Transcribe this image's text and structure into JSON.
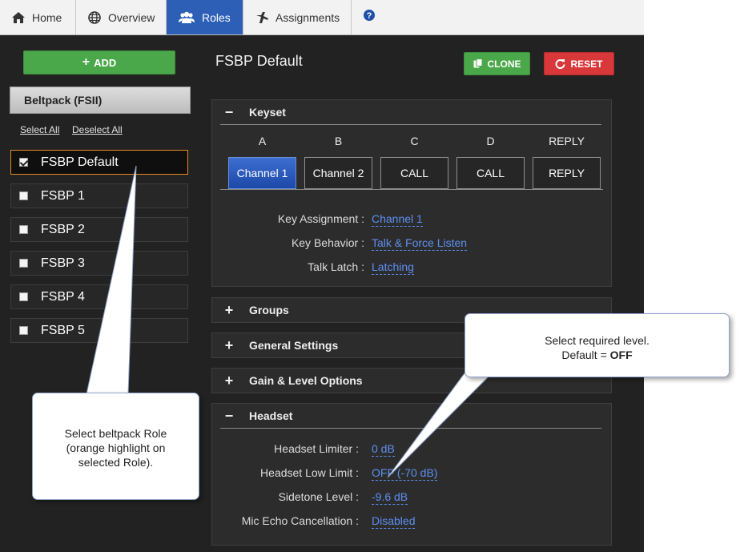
{
  "nav": {
    "tabs": [
      {
        "label": "Home",
        "icon": "home-icon"
      },
      {
        "label": "Overview",
        "icon": "globe-icon"
      },
      {
        "label": "Roles",
        "icon": "users-icon"
      },
      {
        "label": "Assignments",
        "icon": "assignments-icon"
      }
    ],
    "active_tab": "Roles",
    "help_icon": "help-icon"
  },
  "sidebar": {
    "add_label": "ADD",
    "group_label": "Beltpack (FSII)",
    "select_all": "Select All",
    "deselect_all": "Deselect All",
    "roles": [
      {
        "label": "FSBP Default",
        "checked": true
      },
      {
        "label": "FSBP 1",
        "checked": false
      },
      {
        "label": "FSBP 2",
        "checked": false
      },
      {
        "label": "FSBP 3",
        "checked": false
      },
      {
        "label": "FSBP 4",
        "checked": false
      },
      {
        "label": "FSBP 5",
        "checked": false
      }
    ]
  },
  "main": {
    "title": "FSBP Default",
    "clone_label": "CLONE",
    "reset_label": "RESET",
    "keyset": {
      "title": "Keyset",
      "letters": [
        "A",
        "B",
        "C",
        "D",
        "REPLY"
      ],
      "keys": [
        "Channel 1",
        "Channel 2",
        "CALL",
        "CALL",
        "REPLY"
      ],
      "active_key": "Channel 1",
      "props": [
        {
          "label": "Key Assignment :",
          "value": "Channel 1"
        },
        {
          "label": "Key Behavior :",
          "value": "Talk & Force Listen"
        },
        {
          "label": "Talk Latch :",
          "value": "Latching"
        }
      ]
    },
    "collapsed_sections": [
      "Groups",
      "General Settings",
      "Gain & Level Options"
    ],
    "headset": {
      "title": "Headset",
      "props": [
        {
          "label": "Headset Limiter :",
          "value": "0 dB"
        },
        {
          "label": "Headset Low Limit :",
          "value": "OFF (-70 dB)"
        },
        {
          "label": "Sidetone Level :",
          "value": "-9.6 dB"
        },
        {
          "label": "Mic Echo Cancellation :",
          "value": "Disabled"
        }
      ]
    }
  },
  "callouts": {
    "level": {
      "line1": "Select required level.",
      "line2_prefix": "Default = ",
      "line2_bold": "OFF"
    },
    "role": {
      "line1": "Select beltpack Role",
      "line2": "(orange highlight on",
      "line3": "selected Role)."
    }
  },
  "colors": {
    "active_tab": "#2d5fb6",
    "add_button": "#4aa84a",
    "reset_button": "#d9383a",
    "selected_border": "#e58a2a",
    "link": "#5e8ff0"
  }
}
